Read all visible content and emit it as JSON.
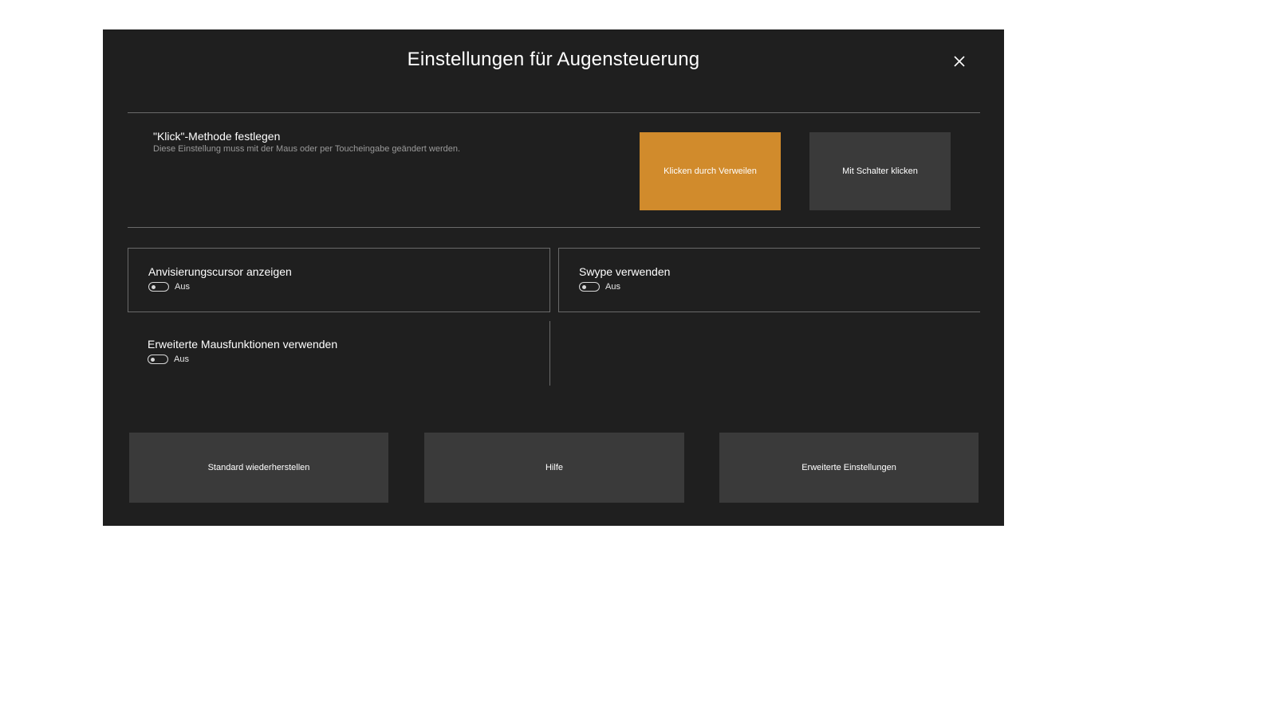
{
  "dialog": {
    "title": "Einstellungen für Augensteuerung",
    "close_icon": "close-icon"
  },
  "click_method": {
    "heading": "\"Klick\"-Methode festlegen",
    "description": "Diese Einstellung muss mit der Maus oder per Toucheingabe geändert werden.",
    "options": [
      {
        "label": "Klicken durch Verweilen",
        "selected": true
      },
      {
        "label": "Mit Schalter klicken",
        "selected": false
      }
    ]
  },
  "settings": [
    {
      "label": "Anvisierungscursor anzeigen",
      "state": "Aus",
      "on": false
    },
    {
      "label": "Swype verwenden",
      "state": "Aus",
      "on": false
    },
    {
      "label": "Erweiterte Mausfunktionen verwenden",
      "state": "Aus",
      "on": false
    }
  ],
  "bottom_buttons": [
    {
      "label": "Standard wiederherstellen"
    },
    {
      "label": "Hilfe"
    },
    {
      "label": "Erweiterte Einstellungen"
    }
  ],
  "colors": {
    "background": "#1f1f1f",
    "accent": "#d18b2c",
    "button": "#3a3a3a",
    "divider": "#6a6a6a"
  }
}
